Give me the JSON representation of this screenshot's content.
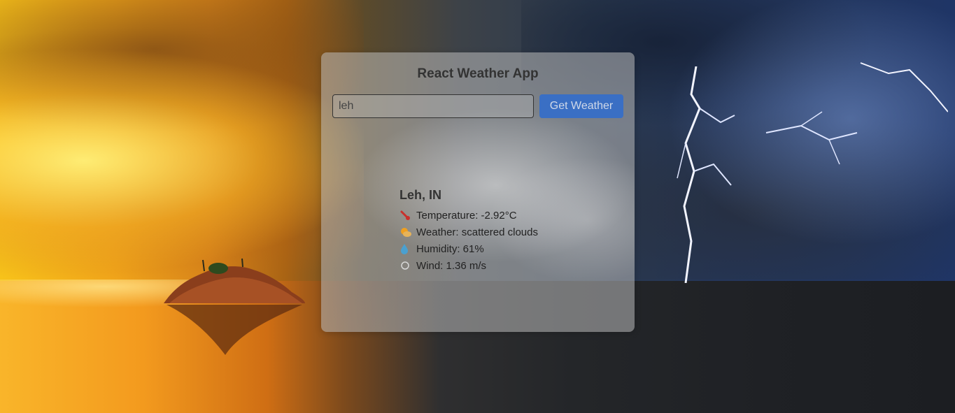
{
  "app": {
    "title": "React Weather App"
  },
  "search": {
    "value": "leh",
    "button_label": "Get Weather"
  },
  "result": {
    "city": "Leh, IN",
    "rows": [
      {
        "icon": "thermometer-icon",
        "text": "Temperature: -2.92°C"
      },
      {
        "icon": "cloud-sun-icon",
        "text": "Weather: scattered clouds"
      },
      {
        "icon": "droplet-icon",
        "text": "Humidity: 61%"
      },
      {
        "icon": "wind-icon",
        "text": "Wind: 1.36 m/s"
      }
    ]
  },
  "colors": {
    "button": "#3a6fc4",
    "card": "rgba(185,185,185,0.55)"
  }
}
